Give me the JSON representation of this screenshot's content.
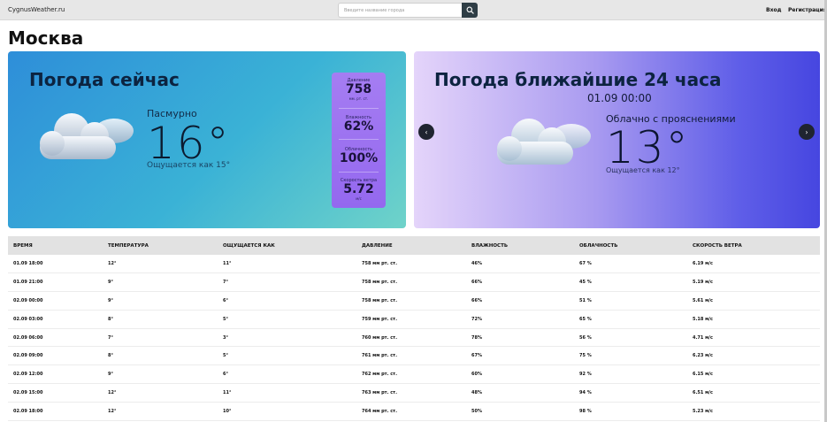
{
  "header": {
    "logo": "CygnusWeather.ru",
    "search_placeholder": "Введите название города",
    "login": "Вход",
    "register": "Регистрация"
  },
  "city": "Москва",
  "now": {
    "title": "Погода сейчас",
    "condition": "Пасмурно",
    "temp": "16°",
    "feels": "Ощущается как 15°",
    "stats": [
      {
        "label": "Давление",
        "value": "758",
        "unit": "мм. рт. ст."
      },
      {
        "label": "Влажность",
        "value": "62%",
        "unit": ""
      },
      {
        "label": "Облачность",
        "value": "100%",
        "unit": ""
      },
      {
        "label": "Скорость ветра",
        "value": "5.72",
        "unit": "м/с"
      }
    ]
  },
  "forecast": {
    "title": "Погода ближайшие 24 часа",
    "date": "01.09 00:00",
    "condition": "Облачно с прояснениями",
    "temp": "13°",
    "feels": "Ощущается как 12°",
    "prev_icon": "chevron-left-icon",
    "next_icon": "chevron-right-icon"
  },
  "table": {
    "headers": [
      "ВРЕМЯ",
      "ТЕМПЕРАТУРА",
      "ОЩУЩАЕТСЯ КАК",
      "ДАВЛЕНИЕ",
      "ВЛАЖНОСТЬ",
      "ОБЛАЧНОСТЬ",
      "СКОРОСТЬ ВЕТРА"
    ],
    "rows": [
      [
        "01.09 18:00",
        "12°",
        "11°",
        "758 мм рт. ст.",
        "46%",
        "67 %",
        "6.19 м/с"
      ],
      [
        "01.09 21:00",
        "9°",
        "7°",
        "758 мм рт. ст.",
        "66%",
        "45 %",
        "5.19 м/с"
      ],
      [
        "02.09 00:00",
        "9°",
        "6°",
        "758 мм рт. ст.",
        "66%",
        "51 %",
        "5.61 м/с"
      ],
      [
        "02.09 03:00",
        "8°",
        "5°",
        "759 мм рт. ст.",
        "72%",
        "65 %",
        "5.18 м/с"
      ],
      [
        "02.09 06:00",
        "7°",
        "3°",
        "760 мм рт. ст.",
        "78%",
        "56 %",
        "4.71 м/с"
      ],
      [
        "02.09 09:00",
        "8°",
        "5°",
        "761 мм рт. ст.",
        "67%",
        "75 %",
        "6.23 м/с"
      ],
      [
        "02.09 12:00",
        "9°",
        "6°",
        "762 мм рт. ст.",
        "60%",
        "92 %",
        "6.15 м/с"
      ],
      [
        "02.09 15:00",
        "12°",
        "11°",
        "763 мм рт. ст.",
        "48%",
        "94 %",
        "6.51 м/с"
      ],
      [
        "02.09 18:00",
        "12°",
        "10°",
        "764 мм рт. ст.",
        "50%",
        "98 %",
        "5.23 м/с"
      ]
    ]
  },
  "colors": {
    "header_bg": "#e7e7e7",
    "search_button": "#2f3e46",
    "stats_panel": "#9468ef",
    "table_header_bg": "#e2e2e2"
  }
}
